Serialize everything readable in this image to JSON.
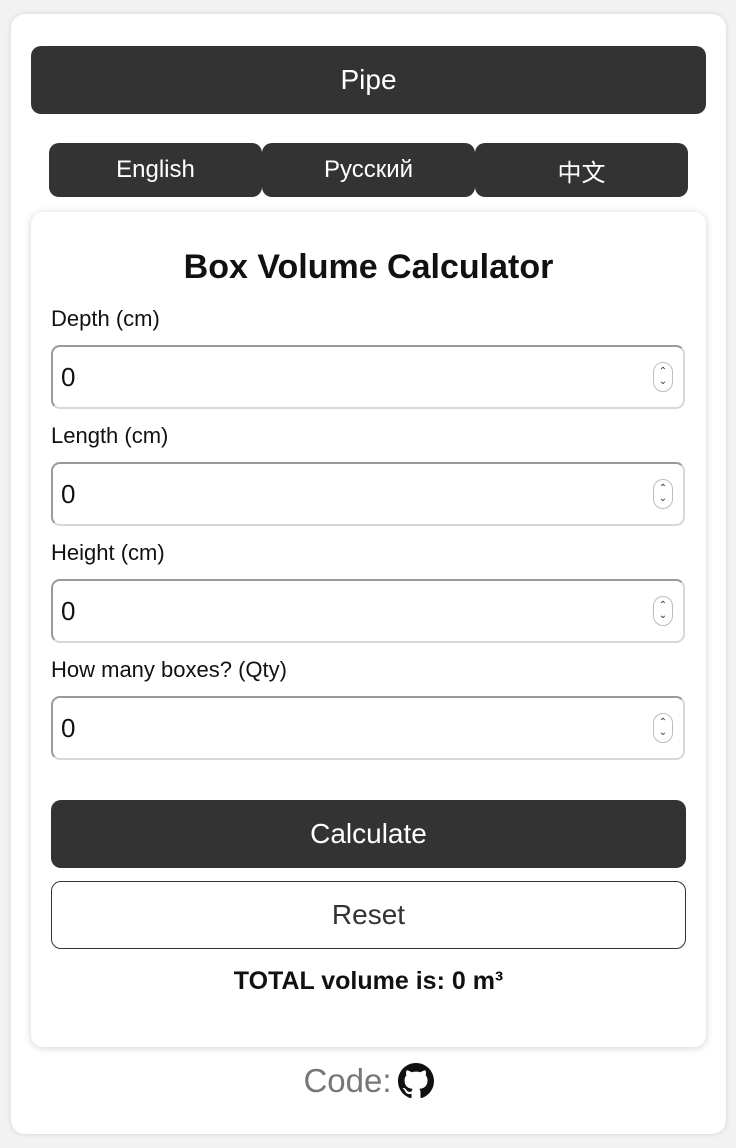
{
  "top_button": {
    "label": "Pipe"
  },
  "languages": [
    {
      "label": "English"
    },
    {
      "label": "Русский"
    },
    {
      "label": "中文"
    }
  ],
  "calculator": {
    "title": "Box Volume Calculator",
    "fields": [
      {
        "label": "Depth (cm)",
        "value": "0"
      },
      {
        "label": "Length (cm)",
        "value": "0"
      },
      {
        "label": "Height (cm)",
        "value": "0"
      },
      {
        "label": "How many boxes? (Qty)",
        "value": "0"
      }
    ],
    "calculate_label": "Calculate",
    "reset_label": "Reset",
    "total_text": "TOTAL volume is: 0 m³"
  },
  "footer": {
    "code_label": "Code:",
    "code_icon": "github-icon"
  },
  "colors": {
    "dark_button": "#333333",
    "background": "#f2f2f2"
  }
}
